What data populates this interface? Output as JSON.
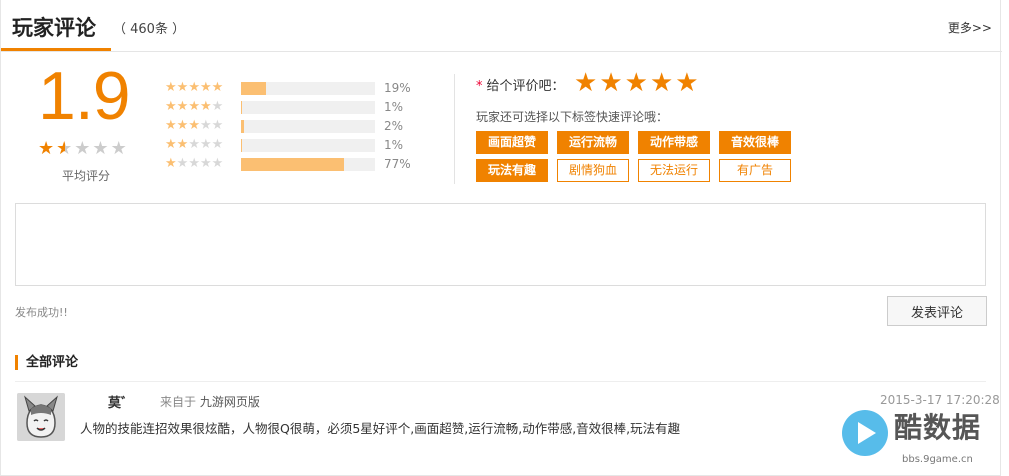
{
  "header": {
    "title": "玩家评论",
    "count": "（ 460条 ）",
    "more": "更多>>"
  },
  "summary": {
    "score": "1.9",
    "score_stars": [
      "full",
      "half",
      "empty",
      "empty",
      "empty"
    ],
    "score_label": "平均评分",
    "distribution": [
      {
        "stars": 5,
        "percent": 19,
        "label": "19%"
      },
      {
        "stars": 4,
        "percent": 1,
        "label": "1%"
      },
      {
        "stars": 3,
        "percent": 2,
        "label": "2%"
      },
      {
        "stars": 2,
        "percent": 1,
        "label": "1%"
      },
      {
        "stars": 1,
        "percent": 77,
        "label": "77%"
      }
    ]
  },
  "rating": {
    "required_mark": "*",
    "label": "给个评价吧：",
    "selected_stars": 5,
    "tag_hint": "玩家还可选择以下标签快速评论哦：",
    "tags": [
      {
        "label": "画面超赞",
        "selected": true
      },
      {
        "label": "运行流畅",
        "selected": true
      },
      {
        "label": "动作带感",
        "selected": true
      },
      {
        "label": "音效很棒",
        "selected": true
      },
      {
        "label": "玩法有趣",
        "selected": true
      },
      {
        "label": "剧情狗血",
        "selected": false
      },
      {
        "label": "无法运行",
        "selected": false
      },
      {
        "label": "有广告",
        "selected": false
      }
    ]
  },
  "composer": {
    "value": "",
    "status": "发布成功!!",
    "submit_label": "发表评论"
  },
  "comments": {
    "title": "全部评论",
    "items": [
      {
        "user": "莫゛",
        "source_prefix": "来自于",
        "source": "九游网页版",
        "time": "2015-3-17 17:20:28",
        "text": "人物的技能连招效果很炫酷，人物很Q很萌，必须5星好评个,画面超赞,运行流畅,动作带感,音效很棒,玩法有趣"
      }
    ]
  },
  "watermark": {
    "text": "酷数据",
    "url": "bbs.9game.cn"
  },
  "colors": {
    "accent": "#f08200",
    "bar": "#fbbf72",
    "star_empty": "#cccccc"
  }
}
